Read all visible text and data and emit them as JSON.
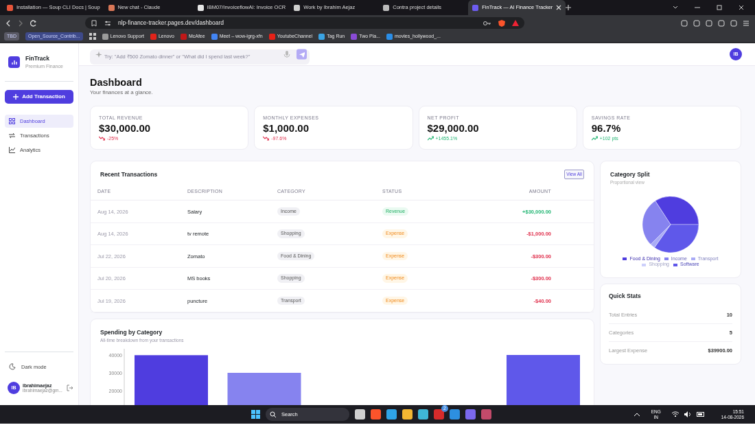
{
  "browser": {
    "tabs": [
      {
        "title": "Installation — Soup CLI Docs | Soup",
        "selected": false,
        "color": "#e8553a"
      },
      {
        "title": "New chat - Claude",
        "selected": false,
        "color": "#d97757"
      },
      {
        "title": "IBM07/InvoiceflowAI: Invoice OCR",
        "selected": false,
        "color": "#e6e6e6"
      },
      {
        "title": "Work by Ibrahim Aejaz",
        "selected": false,
        "color": "#cfcfcf"
      },
      {
        "title": "Contra project details",
        "selected": false,
        "color": "#bbbbbb"
      },
      {
        "title": "FinTrack — AI Finance Tracker",
        "selected": true,
        "color": "#6d5cf0"
      }
    ],
    "address": "nlp-finance-tracker.pages.dev/dashboard",
    "bookmarks": [
      {
        "label": "TBD",
        "kind": "folder",
        "color": "#5a5a66"
      },
      {
        "label": "Open_Source_Contrib...",
        "kind": "folder",
        "color": "#3e4a8a"
      },
      {
        "label": "Lenovo Support",
        "kind": "link",
        "color": "#9a9a9a"
      },
      {
        "label": "Lenovo",
        "kind": "link",
        "color": "#e2231a"
      },
      {
        "label": "McAfee",
        "kind": "link",
        "color": "#c01818"
      },
      {
        "label": "Meet – wow-igrg-xfn",
        "kind": "link",
        "color": "#4285f4"
      },
      {
        "label": "YoutubeChannel",
        "kind": "link",
        "color": "#e62117"
      },
      {
        "label": "Tag Run",
        "kind": "link",
        "color": "#3aa3e3"
      },
      {
        "label": "Two Pla...",
        "kind": "link",
        "color": "#8a4bd6"
      },
      {
        "label": "movies_hollywood_...",
        "kind": "link",
        "color": "#2a8ee8"
      }
    ]
  },
  "sidebar": {
    "brand": "FinTrack",
    "tagline": "Premium Finance",
    "add_button": "Add Transaction",
    "items": [
      {
        "label": "Dashboard",
        "selected": true
      },
      {
        "label": "Transactions",
        "selected": false
      },
      {
        "label": "Analytics",
        "selected": false
      }
    ],
    "dark_mode": "Dark mode",
    "user": {
      "initials": "IB",
      "name": "ibrahimaejaz",
      "email": "ibrahimaejaz@gm..."
    }
  },
  "topbar": {
    "placeholder": "Try: \"Add ₹500 Zomato dinner\" or \"What did I spend last week?\"",
    "avatar": "IB"
  },
  "header": {
    "title": "Dashboard",
    "subtitle": "Your finances at a glance."
  },
  "stats": [
    {
      "label": "TOTAL REVENUE",
      "value": "$30,000.00",
      "change": "-25%",
      "kind": "down"
    },
    {
      "label": "MONTHLY EXPENSES",
      "value": "$1,000.00",
      "change": "-97.6%",
      "kind": "down"
    },
    {
      "label": "NET PROFIT",
      "value": "$29,000.00",
      "change": "+1455.1%",
      "kind": "up"
    },
    {
      "label": "SAVINGS RATE",
      "value": "96.7%",
      "change": "+102 pts",
      "kind": "up"
    }
  ],
  "transactions": {
    "title": "Recent Transactions",
    "view_all": "View All",
    "columns": [
      "DATE",
      "DESCRIPTION",
      "CATEGORY",
      "STATUS",
      "AMOUNT"
    ],
    "rows": [
      {
        "date": "Aug 14, 2026",
        "description": "Salary",
        "category": "Income",
        "status": "Revenue",
        "kind": "revenue",
        "amount": "+$30,000.00"
      },
      {
        "date": "Aug 14, 2026",
        "description": "tv remote",
        "category": "Shopping",
        "status": "Expense",
        "kind": "expense",
        "amount": "-$1,000.00"
      },
      {
        "date": "Jul 22, 2026",
        "description": "Zomato",
        "category": "Food & Dining",
        "status": "Expense",
        "kind": "expense",
        "amount": "-$300.00"
      },
      {
        "date": "Jul 20, 2026",
        "description": "MS books",
        "category": "Shopping",
        "status": "Expense",
        "kind": "expense",
        "amount": "-$300.00"
      },
      {
        "date": "Jul 19, 2026",
        "description": "puncture",
        "category": "Transport",
        "status": "Expense",
        "kind": "expense",
        "amount": "-$40.00"
      }
    ]
  },
  "category_split": {
    "title": "Category Split",
    "subtitle": "Proportional view",
    "legend": [
      {
        "label": "Food & Dining",
        "color": "#4f3ddf"
      },
      {
        "label": "Income",
        "color": "#8683ef"
      },
      {
        "label": "Transport",
        "color": "#a9abf6"
      },
      {
        "label": "Shopping",
        "color": "#cdd0fb"
      },
      {
        "label": "Software",
        "color": "#5f58ea"
      }
    ]
  },
  "quick_stats": {
    "title": "Quick Stats",
    "rows": [
      {
        "label": "Total Entries",
        "value": "10"
      },
      {
        "label": "Categories",
        "value": "5"
      },
      {
        "label": "Largest Expense",
        "value": "$39900.00"
      }
    ]
  },
  "spending": {
    "title": "Spending by Category",
    "subtitle": "All-time breakdown from your transactions",
    "axis_labels": [
      "40000",
      "30000",
      "20000"
    ]
  },
  "taskbar": {
    "search": "Search",
    "badge": "2",
    "language": "ENG",
    "region": "IN",
    "time": "15:51",
    "date": "14-08-2026"
  }
}
